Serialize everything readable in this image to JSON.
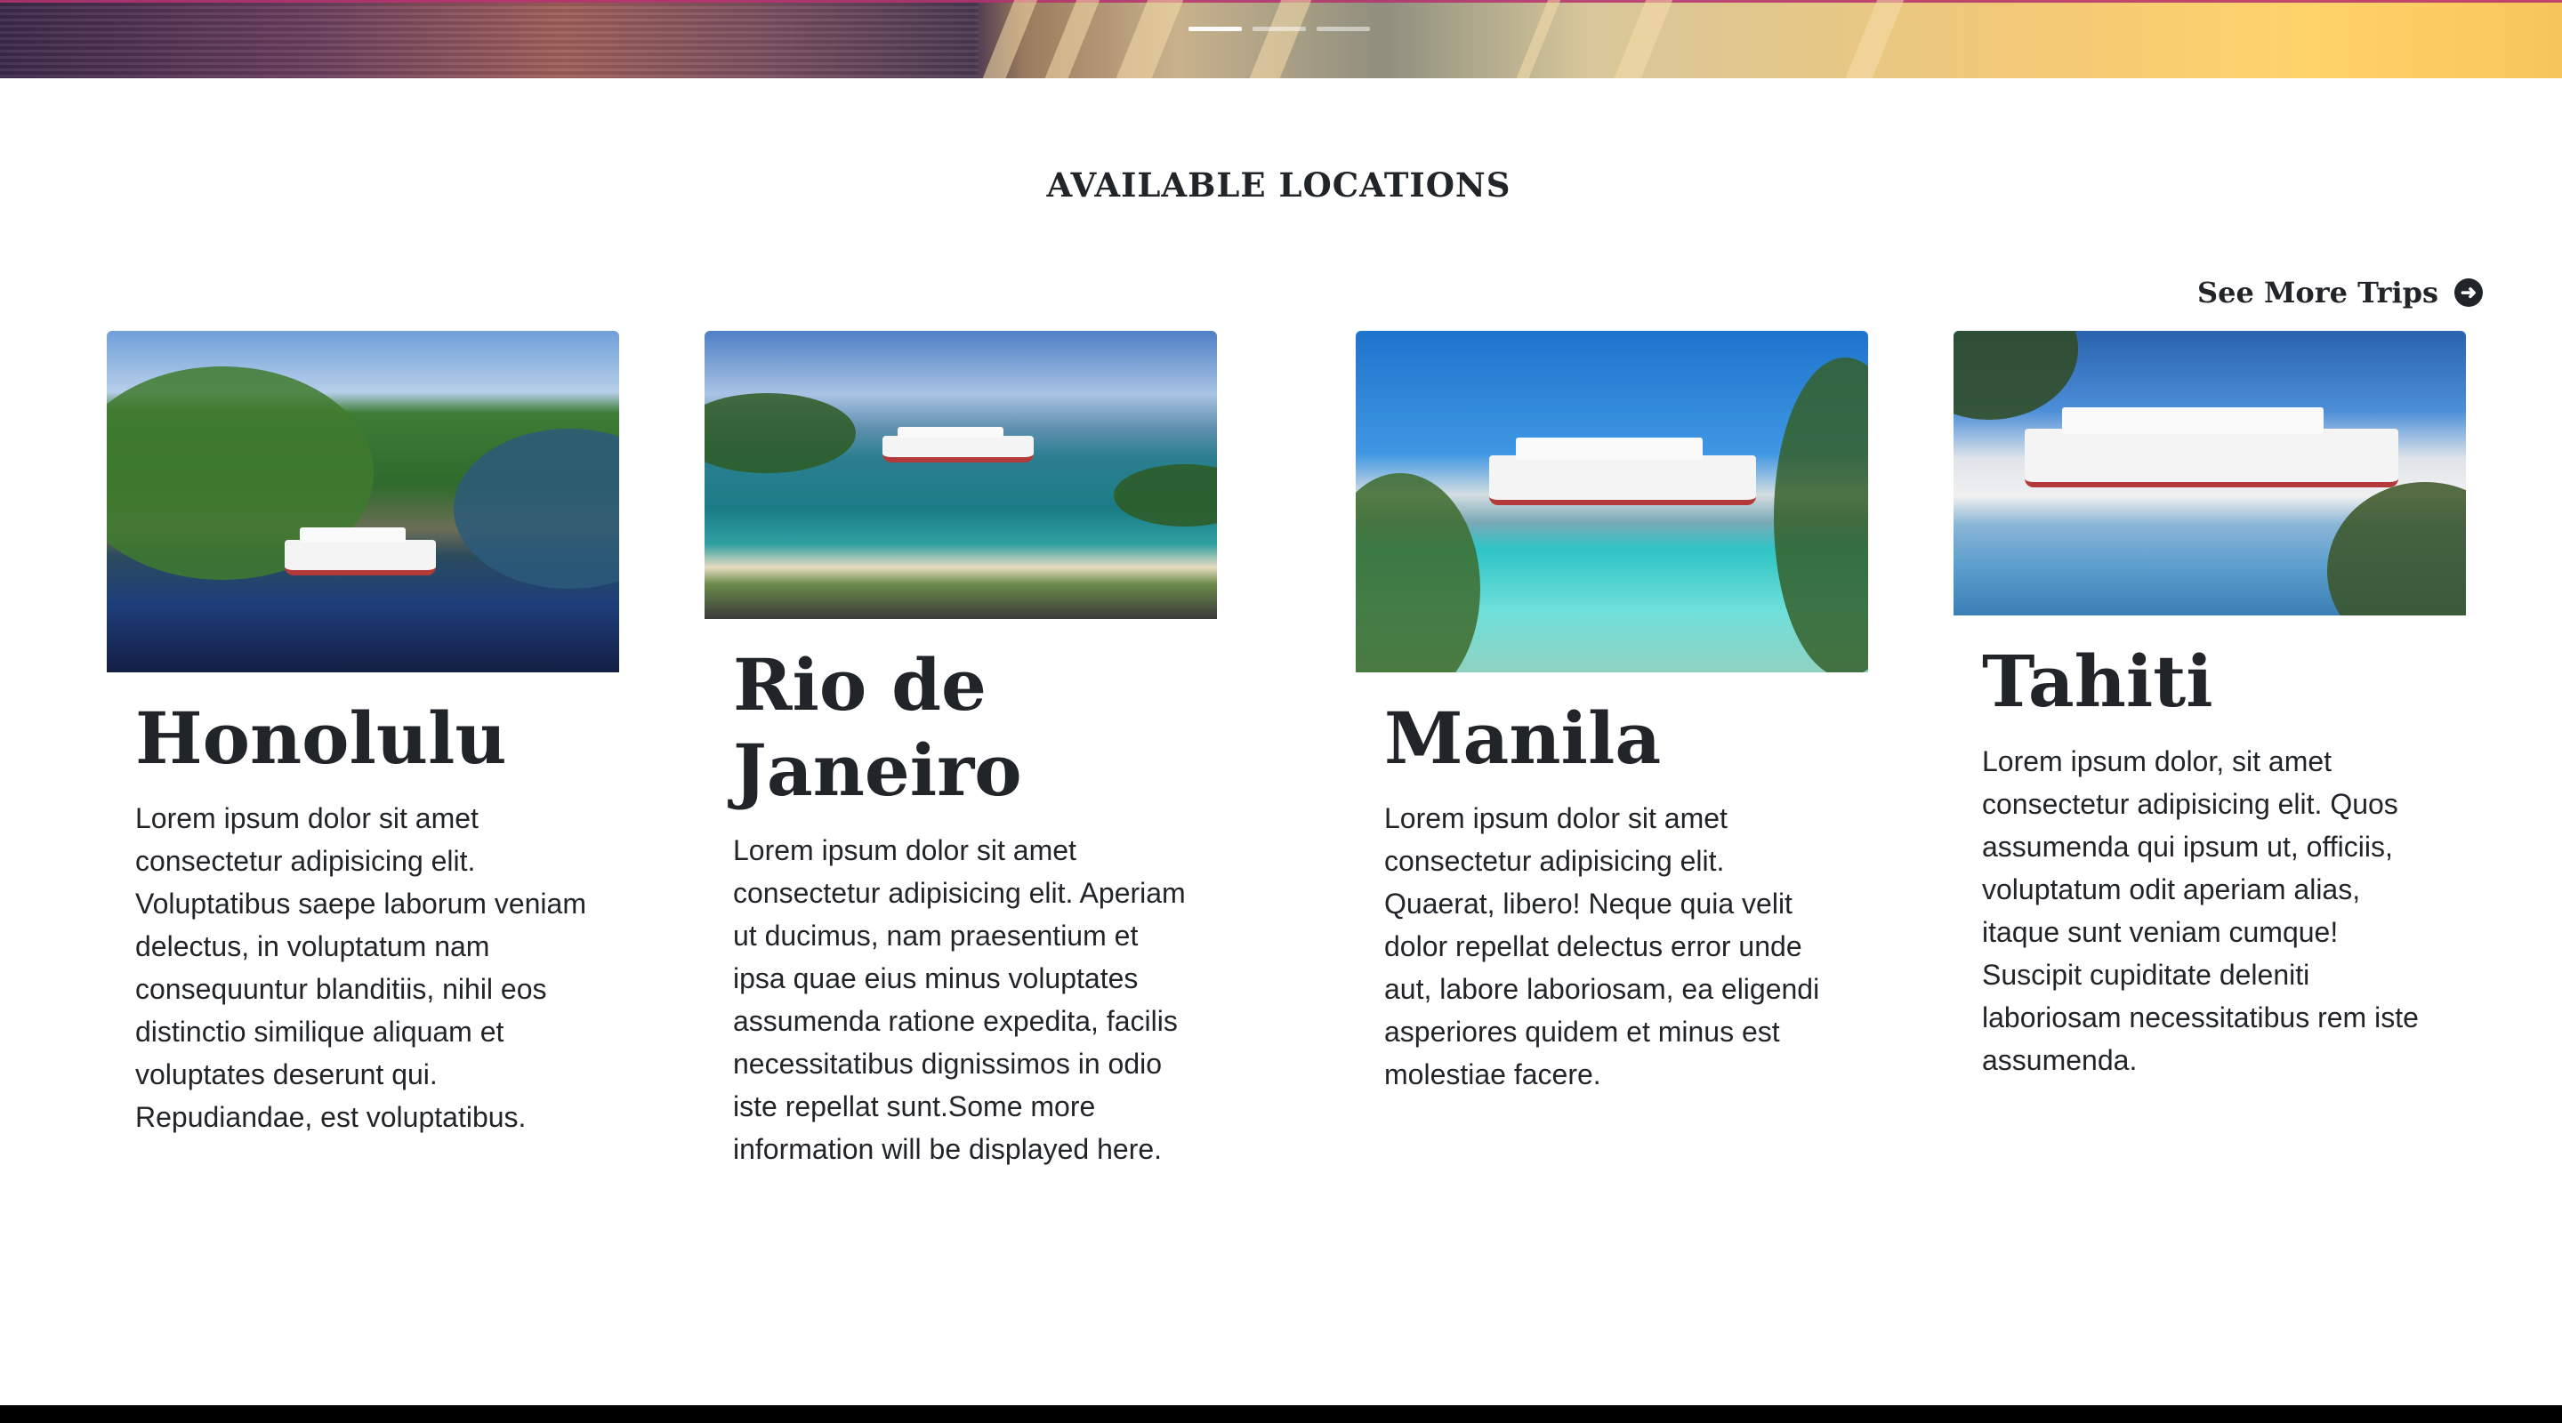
{
  "section": {
    "title": "AVAILABLE LOCATIONS"
  },
  "see_more": {
    "label": "See More Trips",
    "icon": "arrow-right-circle-icon"
  },
  "carousel": {
    "indicator_count": 3,
    "active_indicator": 1
  },
  "cards": [
    {
      "title": "Honolulu",
      "text": "Lorem ipsum dolor sit amet consectetur adipisicing elit. Voluptatibus saepe laborum veniam delectus, in voluptatum nam consequuntur blanditiis, nihil eos distinctio similique aliquam et voluptates deserunt qui. Repudiandae, est voluptatibus."
    },
    {
      "title": "Rio de Janeiro",
      "text": "Lorem ipsum dolor sit amet consectetur adipisicing elit. Aperiam ut ducimus, nam praesentium et ipsa quae eius minus voluptates assumenda ratione expedita, facilis necessitatibus dignissimos in odio iste repellat sunt.Some more information will be displayed here."
    },
    {
      "title": "Manila",
      "text": "Lorem ipsum dolor sit amet consectetur adipisicing elit. Quaerat, libero! Neque quia velit dolor repellat delectus error unde aut, labore laboriosam, ea eligendi asperiores quidem et minus est molestiae facere."
    },
    {
      "title": "Tahiti",
      "text": "Lorem ipsum dolor, sit amet consectetur adipisicing elit. Quos assumenda qui ipsum ut, officiis, voluptatum odit aperiam alias, itaque sunt veniam cumque! Suscipit cupiditate deleniti laboriosam necessitatibus rem iste assumenda."
    }
  ]
}
